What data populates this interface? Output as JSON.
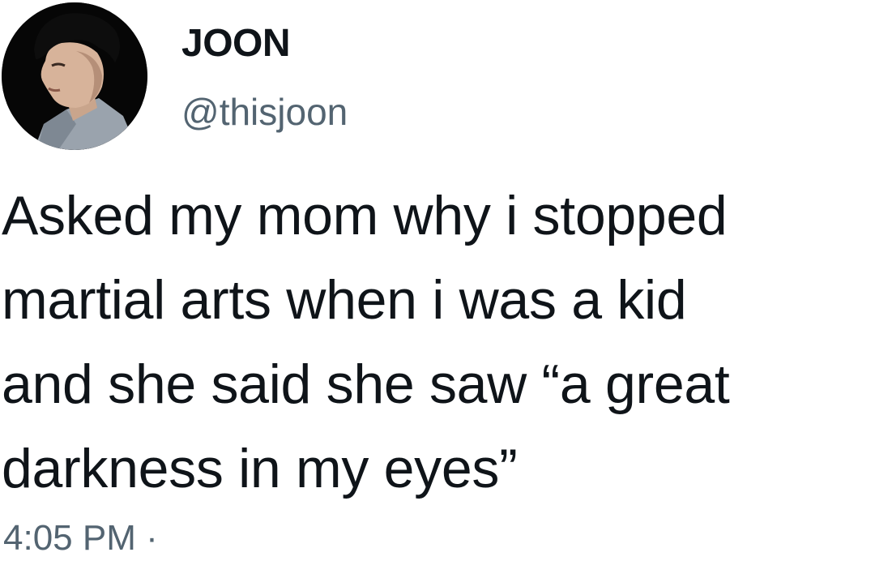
{
  "author": {
    "display_name": "JOON",
    "handle": "@thisjoon",
    "avatar_icon": "profile-photo"
  },
  "tweet": {
    "lines": [
      "Asked my mom why i stopped",
      "martial arts when i was a kid",
      "and she said she saw “a great",
      "darkness in my eyes”"
    ]
  },
  "meta": {
    "time": "4:05 PM",
    "separator": "·"
  },
  "colors": {
    "text": "#0f1419",
    "secondary": "#536471",
    "background": "#ffffff"
  }
}
